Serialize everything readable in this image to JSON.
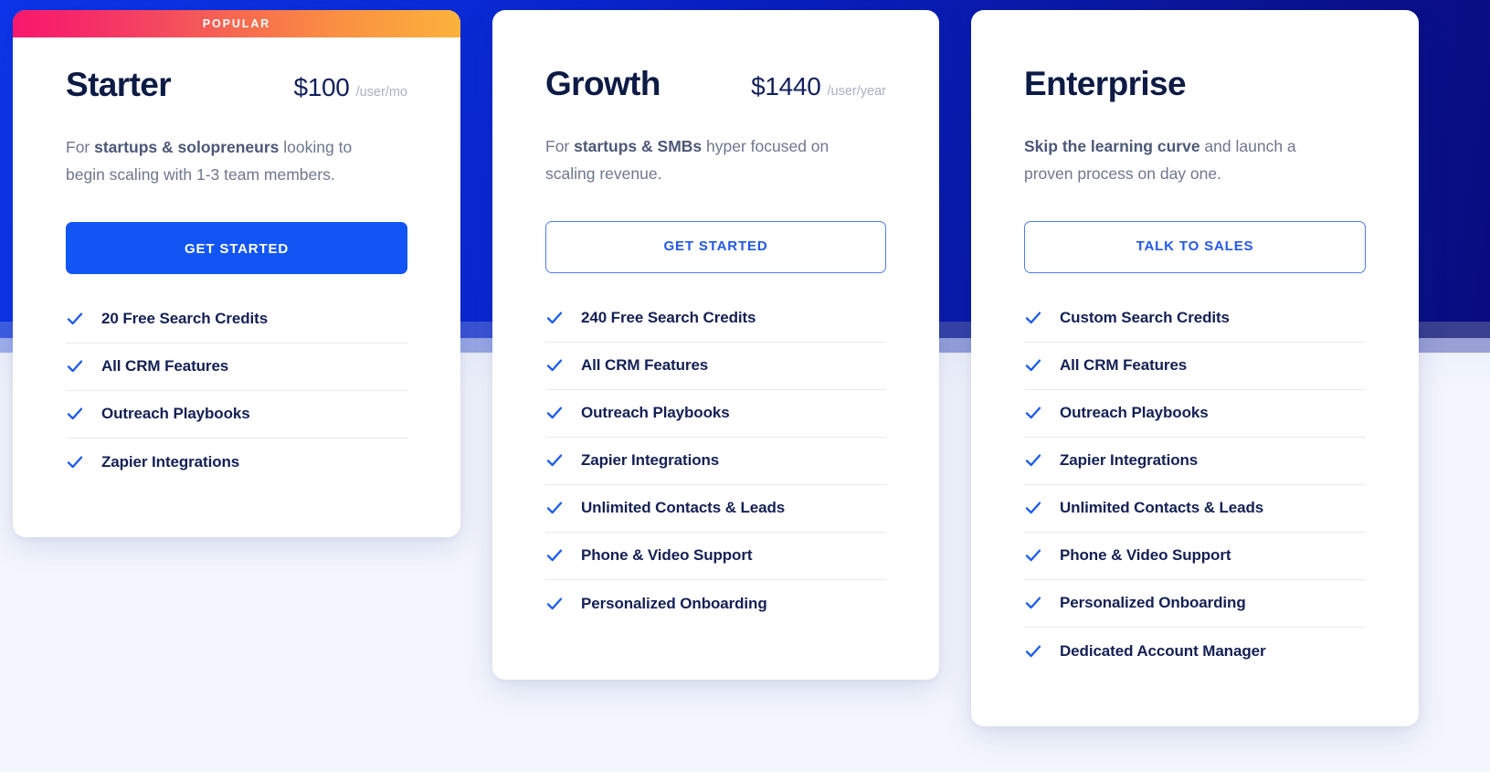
{
  "theme": {
    "accent_blue": "#1155F5",
    "outline_blue": "#2357EE",
    "heading_navy": "#0D1B45",
    "body_gray": "#6D778F",
    "period_gray": "#A9B0C4",
    "divider": "#E7EAF2",
    "ribbon_gradient_from": "#F9186C",
    "ribbon_gradient_to": "#FBB23C",
    "bg_blue_from": "#0D34E8",
    "bg_blue_to": "#090C80",
    "page_bg": "#F3F6FD"
  },
  "icons": {
    "check": "check-icon"
  },
  "plans": [
    {
      "id": "starter",
      "badge": "POPULAR",
      "has_badge": true,
      "name": "Starter",
      "price": "$100",
      "period": "/user/mo",
      "desc_pre": "For ",
      "desc_bold": "startups & solopreneurs",
      "desc_post": " looking to begin scaling with 1-3 team members.",
      "cta_label": "GET STARTED",
      "cta_style": "primary",
      "features": [
        "20 Free Search Credits",
        "All CRM Features",
        "Outreach Playbooks",
        "Zapier Integrations"
      ]
    },
    {
      "id": "growth",
      "badge": "",
      "has_badge": false,
      "name": "Growth",
      "price": "$1440",
      "period": "/user/year",
      "desc_pre": "For ",
      "desc_bold": "startups & SMBs",
      "desc_post": " hyper focused on scaling revenue.",
      "cta_label": "GET STARTED",
      "cta_style": "outline",
      "features": [
        "240 Free Search Credits",
        "All CRM Features",
        "Outreach Playbooks",
        "Zapier Integrations",
        "Unlimited Contacts & Leads",
        "Phone & Video Support",
        "Personalized Onboarding"
      ]
    },
    {
      "id": "enterprise",
      "badge": "",
      "has_badge": false,
      "name": "Enterprise",
      "price": "",
      "period": "",
      "desc_pre": "",
      "desc_bold": "Skip the learning curve",
      "desc_post": " and launch a proven process on day one.",
      "cta_label": "TALK TO SALES",
      "cta_style": "outline",
      "features": [
        "Custom Search Credits",
        "All CRM Features",
        "Outreach Playbooks",
        "Zapier Integrations",
        "Unlimited Contacts & Leads",
        "Phone & Video Support",
        "Personalized Onboarding",
        "Dedicated Account Manager"
      ]
    }
  ]
}
